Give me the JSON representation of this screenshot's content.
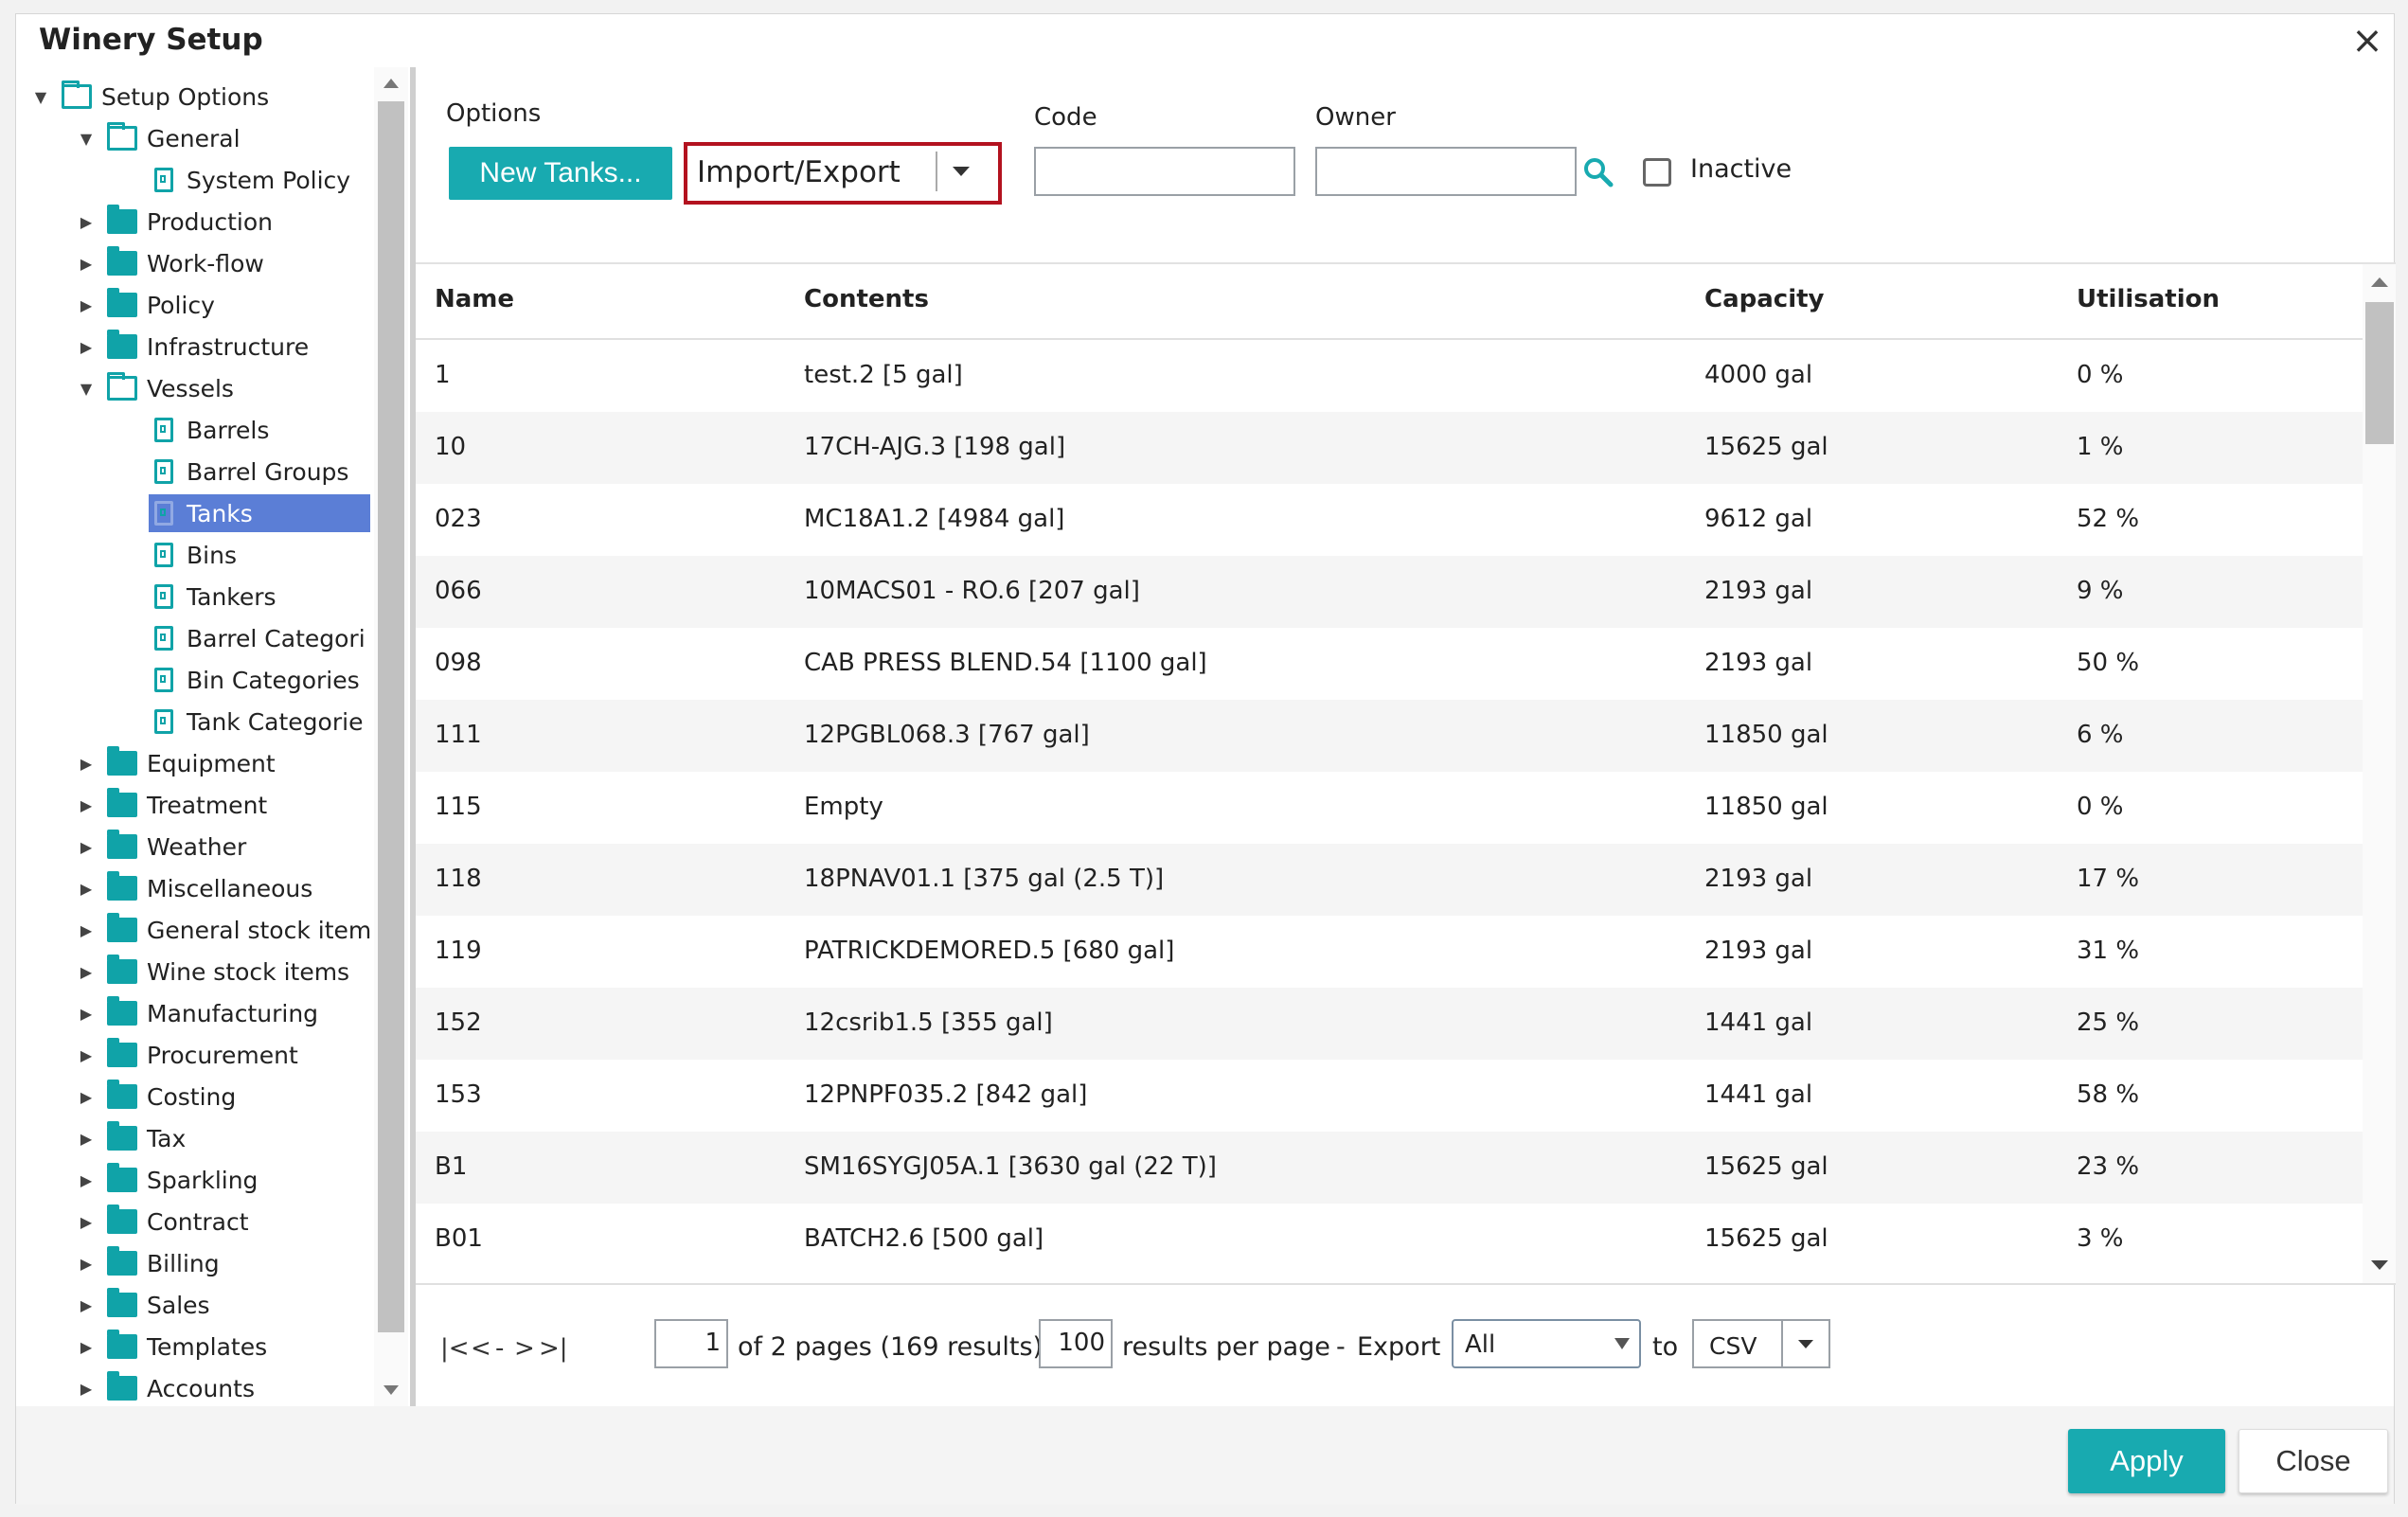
{
  "window": {
    "title": "Winery Setup",
    "close_glyph": "×"
  },
  "tree": [
    {
      "label": "Setup Options",
      "level": 0,
      "type": "folder-open",
      "chev": "down"
    },
    {
      "label": "General",
      "level": 1,
      "type": "folder-open",
      "chev": "down"
    },
    {
      "label": "System Policy",
      "level": 2,
      "type": "doc",
      "chev": ""
    },
    {
      "label": "Production",
      "level": 1,
      "type": "folder",
      "chev": "right"
    },
    {
      "label": "Work-flow",
      "level": 1,
      "type": "folder",
      "chev": "right"
    },
    {
      "label": "Policy",
      "level": 1,
      "type": "folder",
      "chev": "right"
    },
    {
      "label": "Infrastructure",
      "level": 1,
      "type": "folder",
      "chev": "right"
    },
    {
      "label": "Vessels",
      "level": 1,
      "type": "folder-open",
      "chev": "down"
    },
    {
      "label": "Barrels",
      "level": 2,
      "type": "doc",
      "chev": ""
    },
    {
      "label": "Barrel Groups",
      "level": 2,
      "type": "doc",
      "chev": ""
    },
    {
      "label": "Tanks",
      "level": 2,
      "type": "doc",
      "chev": "",
      "selected": true
    },
    {
      "label": "Bins",
      "level": 2,
      "type": "doc",
      "chev": ""
    },
    {
      "label": "Tankers",
      "level": 2,
      "type": "doc",
      "chev": ""
    },
    {
      "label": "Barrel Categori",
      "level": 2,
      "type": "doc",
      "chev": ""
    },
    {
      "label": "Bin Categories",
      "level": 2,
      "type": "doc",
      "chev": ""
    },
    {
      "label": "Tank Categorie",
      "level": 2,
      "type": "doc",
      "chev": ""
    },
    {
      "label": "Equipment",
      "level": 1,
      "type": "folder",
      "chev": "right"
    },
    {
      "label": "Treatment",
      "level": 1,
      "type": "folder",
      "chev": "right"
    },
    {
      "label": "Weather",
      "level": 1,
      "type": "folder",
      "chev": "right"
    },
    {
      "label": "Miscellaneous",
      "level": 1,
      "type": "folder",
      "chev": "right"
    },
    {
      "label": "General stock item",
      "level": 1,
      "type": "folder",
      "chev": "right"
    },
    {
      "label": "Wine stock items",
      "level": 1,
      "type": "folder",
      "chev": "right"
    },
    {
      "label": "Manufacturing",
      "level": 1,
      "type": "folder",
      "chev": "right"
    },
    {
      "label": "Procurement",
      "level": 1,
      "type": "folder",
      "chev": "right"
    },
    {
      "label": "Costing",
      "level": 1,
      "type": "folder",
      "chev": "right"
    },
    {
      "label": "Tax",
      "level": 1,
      "type": "folder",
      "chev": "right"
    },
    {
      "label": "Sparkling",
      "level": 1,
      "type": "folder",
      "chev": "right"
    },
    {
      "label": "Contract",
      "level": 1,
      "type": "folder",
      "chev": "right"
    },
    {
      "label": "Billing",
      "level": 1,
      "type": "folder",
      "chev": "right"
    },
    {
      "label": "Sales",
      "level": 1,
      "type": "folder",
      "chev": "right"
    },
    {
      "label": "Templates",
      "level": 1,
      "type": "folder",
      "chev": "right"
    },
    {
      "label": "Accounts",
      "level": 1,
      "type": "folder",
      "chev": "right"
    }
  ],
  "options": {
    "label": "Options",
    "new_tanks": "New Tanks...",
    "import_export": "Import/Export",
    "code_label": "Code",
    "code_value": "",
    "owner_label": "Owner",
    "owner_value": "",
    "inactive_label": "Inactive",
    "inactive_checked": false
  },
  "table": {
    "headers": {
      "name": "Name",
      "contents": "Contents",
      "capacity": "Capacity",
      "utilisation": "Utilisation"
    },
    "rows": [
      {
        "name": "1",
        "contents": "test.2 [5 gal]",
        "capacity": "4000 gal",
        "utilisation": "0 %"
      },
      {
        "name": "10",
        "contents": "17CH-AJG.3 [198 gal]",
        "capacity": "15625 gal",
        "utilisation": "1 %"
      },
      {
        "name": "023",
        "contents": "MC18A1.2 [4984 gal]",
        "capacity": "9612 gal",
        "utilisation": "52 %"
      },
      {
        "name": "066",
        "contents": "10MACS01 - RO.6 [207 gal]",
        "capacity": "2193 gal",
        "utilisation": "9 %"
      },
      {
        "name": "098",
        "contents": "CAB PRESS BLEND.54 [1100 gal]",
        "capacity": "2193 gal",
        "utilisation": "50 %"
      },
      {
        "name": "111",
        "contents": "12PGBL068.3 [767 gal]",
        "capacity": "11850 gal",
        "utilisation": "6 %"
      },
      {
        "name": "115",
        "contents": "Empty",
        "capacity": "11850 gal",
        "utilisation": "0 %"
      },
      {
        "name": "118",
        "contents": "18PNAV01.1 [375 gal (2.5 T)]",
        "capacity": "2193 gal",
        "utilisation": "17 %"
      },
      {
        "name": "119",
        "contents": "PATRICKDEMORED.5 [680 gal]",
        "capacity": "2193 gal",
        "utilisation": "31 %"
      },
      {
        "name": "152",
        "contents": "12csrib1.5 [355 gal]",
        "capacity": "1441 gal",
        "utilisation": "25 %"
      },
      {
        "name": "153",
        "contents": "12PNPF035.2 [842 gal]",
        "capacity": "1441 gal",
        "utilisation": "58 %"
      },
      {
        "name": "B1",
        "contents": "SM16SYGJ05A.1 [3630 gal (22 T)]",
        "capacity": "15625 gal",
        "utilisation": "23 %"
      },
      {
        "name": "B01",
        "contents": "BATCH2.6 [500 gal]",
        "capacity": "15625 gal",
        "utilisation": "3 %"
      }
    ]
  },
  "pager": {
    "first": "|<",
    "prev": "<",
    "dash": "-",
    "next": ">",
    "last": ">|",
    "page": "1",
    "of_text": "of 2 pages (169 results).",
    "per_page": "100",
    "per_page_text": "results per page",
    "dash2": "-",
    "export_label": "Export",
    "export_scope": "All",
    "to_label": "to",
    "format": "CSV"
  },
  "footer": {
    "apply": "Apply",
    "close": "Close"
  }
}
